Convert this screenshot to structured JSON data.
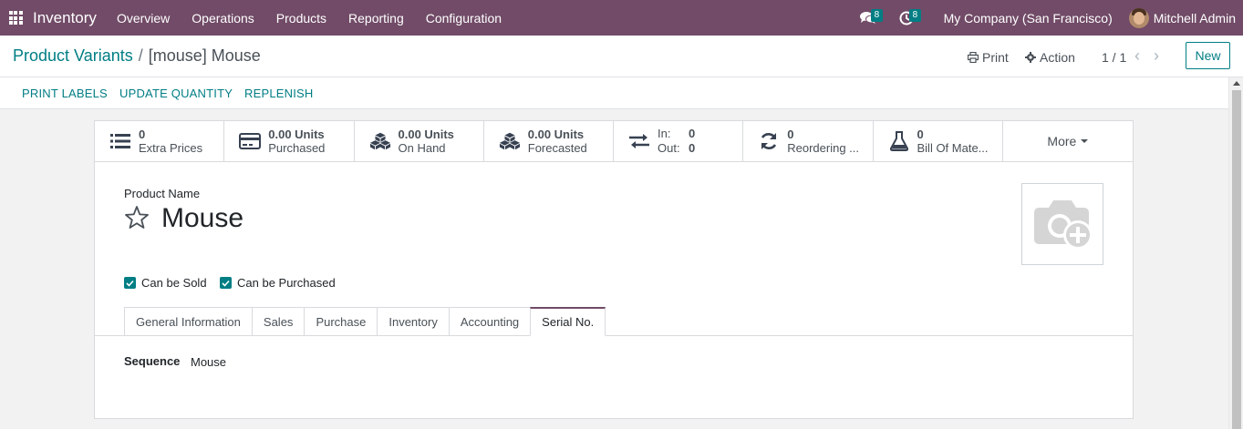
{
  "navbar": {
    "app_name": "Inventory",
    "menu": [
      "Overview",
      "Operations",
      "Products",
      "Reporting",
      "Configuration"
    ],
    "messages_count": "8",
    "activities_count": "8",
    "company": "My Company (San Francisco)",
    "user": "Mitchell Admin",
    "background_color": "#714b67"
  },
  "breadcrumb": {
    "parent": "Product Variants",
    "separator": "/",
    "current": "[mouse] Mouse"
  },
  "control_panel": {
    "print_label": "Print",
    "action_label": "Action",
    "pager": "1 / 1",
    "new_label": "New"
  },
  "header_buttons": [
    "PRINT LABELS",
    "UPDATE QUANTITY",
    "REPLENISH"
  ],
  "smart_buttons": [
    {
      "icon": "list-icon",
      "value": "0",
      "label": "Extra Prices"
    },
    {
      "icon": "credit-card-icon",
      "value": "0.00 Units",
      "label": "Purchased"
    },
    {
      "icon": "cubes-icon",
      "value": "0.00 Units",
      "label": "On Hand"
    },
    {
      "icon": "cubes-icon",
      "value": "0.00 Units",
      "label": "Forecasted"
    },
    {
      "icon": "exchange-icon",
      "in_label": "In:",
      "in_value": "0",
      "out_label": "Out:",
      "out_value": "0"
    },
    {
      "icon": "refresh-icon",
      "value": "0",
      "label": "Reordering ..."
    },
    {
      "icon": "flask-icon",
      "value": "0",
      "label": "Bill Of Mate..."
    },
    {
      "label": "More"
    }
  ],
  "form": {
    "product_name_label": "Product Name",
    "product_name": "Mouse",
    "can_be_sold_label": "Can be Sold",
    "can_be_sold": true,
    "can_be_purchased_label": "Can be Purchased",
    "can_be_purchased": true,
    "tabs": [
      "General Information",
      "Sales",
      "Purchase",
      "Inventory",
      "Accounting",
      "Serial No."
    ],
    "active_tab": "Serial No.",
    "sequence_label": "Sequence",
    "sequence_value": "Mouse"
  },
  "colors": {
    "accent": "#017e84",
    "brand": "#714b67"
  }
}
